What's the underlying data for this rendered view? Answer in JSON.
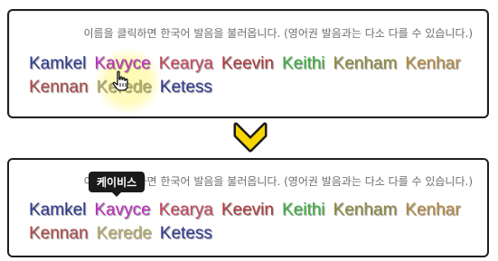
{
  "hint_text": "이름을 클릭하면 한국어 발음을 불러옵니다. (영어권 발음과는 다소 다를 수 있습니다.)",
  "tooltip_text": "케이비스",
  "names": [
    {
      "label": "Kamkel",
      "color": "#2f3a93"
    },
    {
      "label": "Kavyce",
      "color": "#bf2fbf"
    },
    {
      "label": "Kearya",
      "color": "#c8485e"
    },
    {
      "label": "Keevin",
      "color": "#b03a3a"
    },
    {
      "label": "Keithi",
      "color": "#3fae3f"
    },
    {
      "label": "Kenham",
      "color": "#8d8a3f"
    },
    {
      "label": "Kenhar",
      "color": "#b58a40"
    },
    {
      "label": "Kennan",
      "color": "#b04848"
    },
    {
      "label": "Kerede",
      "color": "#b5ad6a"
    },
    {
      "label": "Ketess",
      "color": "#2f3a93"
    }
  ],
  "icons": {
    "cursor": "hand-pointer-icon",
    "arrow": "chevron-down-icon",
    "arrow_color": "#f7d500"
  }
}
